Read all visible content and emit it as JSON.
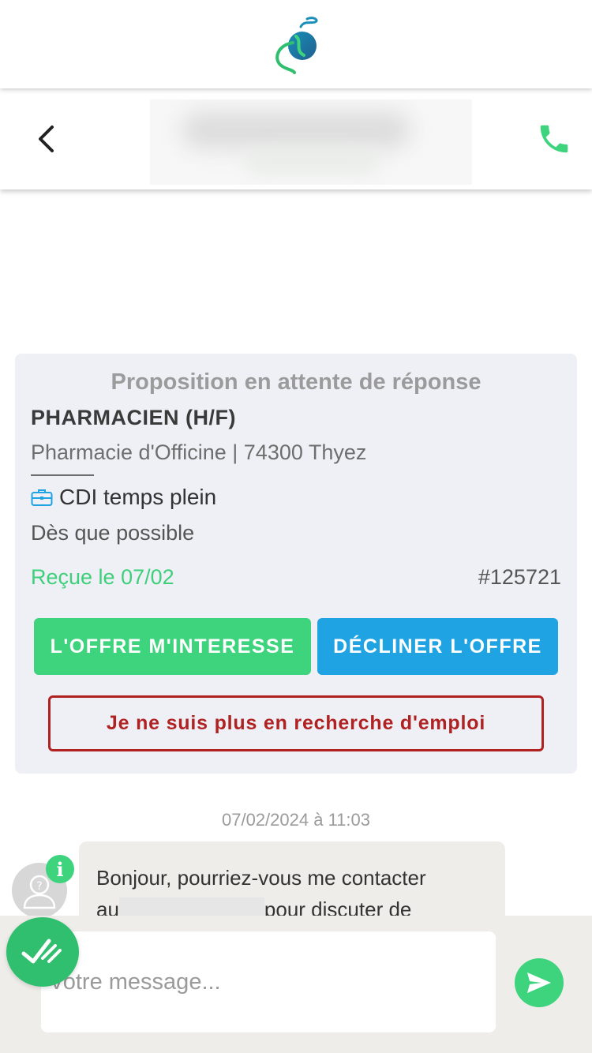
{
  "header": {
    "logo_icon": "seahorse-logo-icon",
    "back_icon": "chevron-left-icon",
    "call_icon": "phone-icon",
    "contact_name": "",
    "accent_color": "#3ed37d"
  },
  "offer": {
    "status": "Proposition en attente de réponse",
    "title": "PHARMACIEN (H/F)",
    "company": "Pharmacie d'Officine | 74300 Thyez",
    "contract_icon": "briefcase-icon",
    "contract": "CDI temps plein",
    "start": "Dès que possible",
    "received": "Reçue le 07/02",
    "reference": "#125721",
    "interest_label": "L'OFFRE M'INTERESSE",
    "decline_label": "DÉCLINER L'OFFRE",
    "no_search_label": "Je ne suis plus en recherche d'emploi",
    "colors": {
      "interest": "#3ed37d",
      "decline": "#1fa3e2",
      "no_search": "#b02222"
    }
  },
  "messages": {
    "timestamp": "07/02/2024 à 11:03",
    "avatar_icon": "unknown-user-avatar-icon",
    "info_badge": "i",
    "first": {
      "line1": "Bonjour, pourriez-vous me contacter",
      "line2_prefix": "au",
      "line2_suffix": "pour discuter de"
    }
  },
  "composer": {
    "placeholder": "Votre message...",
    "send_icon": "send-arrow-icon",
    "fab_icon": "check-wave-icon"
  }
}
